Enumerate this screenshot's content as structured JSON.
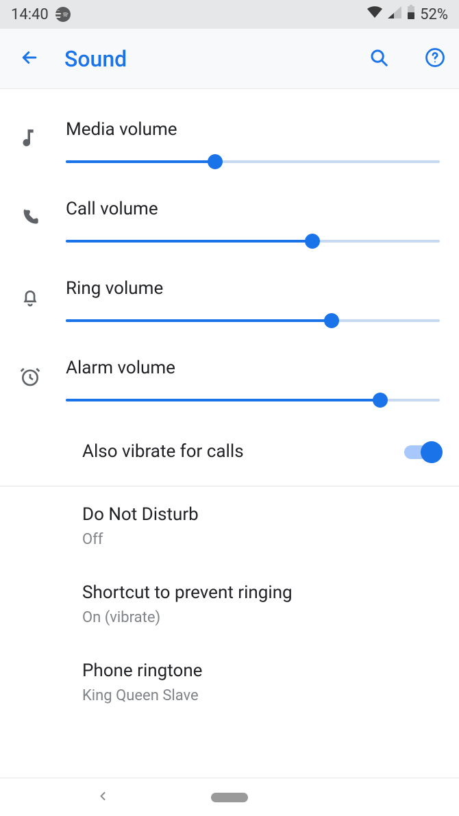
{
  "status": {
    "time": "14:40",
    "battery": "52%"
  },
  "header": {
    "title": "Sound"
  },
  "sliders": {
    "media": {
      "label": "Media volume",
      "percent": 40
    },
    "call": {
      "label": "Call volume",
      "percent": 66
    },
    "ring": {
      "label": "Ring volume",
      "percent": 71
    },
    "alarm": {
      "label": "Alarm volume",
      "percent": 84
    }
  },
  "toggles": {
    "vibrate_calls": {
      "label": "Also vibrate for calls",
      "on": true
    }
  },
  "prefs": {
    "dnd": {
      "title": "Do Not Disturb",
      "subtitle": "Off"
    },
    "shortcut": {
      "title": "Shortcut to prevent ringing",
      "subtitle": "On (vibrate)"
    },
    "ringtone": {
      "title": "Phone ringtone",
      "subtitle": "King Queen Slave"
    }
  },
  "colors": {
    "accent": "#1a73e8"
  }
}
